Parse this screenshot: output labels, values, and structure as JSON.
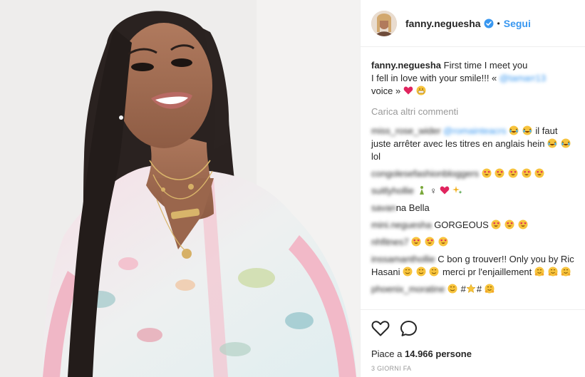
{
  "post": {
    "username": "fanny.neguesha",
    "separator": "•",
    "follow_label": "Segui"
  },
  "caption": {
    "username": "fanny.neguesha",
    "text_line1": "First time I meet you",
    "text_line2": "I fell in love with your smile!!! «",
    "mention": "@tamarr13",
    "text_line3": "voice »"
  },
  "load_more_label": "Carica altri commenti",
  "comments": [
    {
      "user": "miss_rose_wider",
      "mention": "@romainteacrs",
      "text": "il faut juste arrêter avec les titres en anglais hein",
      "tail": "lol"
    },
    {
      "user": "congolesefashionbloggers"
    },
    {
      "user": "suitlyhollie",
      "mid": "♀"
    },
    {
      "user": "savannah",
      "text": "na Bella"
    },
    {
      "user": "mini.neguesha",
      "text": "GORGEOUS"
    },
    {
      "user": "nhfitnes7"
    },
    {
      "user": "inssamanthollie",
      "text": "C bon g trouver!! Only you by Ric Hasani",
      "text2": "merci pr l'enjaillement"
    },
    {
      "user": "phoenix_moratine"
    }
  ],
  "likes": {
    "prefix": "Piace a",
    "count": "14.966",
    "suffix": "persone"
  },
  "timestamp": "3 GIORNI FA",
  "icons": {
    "like": "heart-icon",
    "comment": "comment-icon",
    "verified": "verified-badge-icon"
  },
  "colors": {
    "accent": "#3897f0",
    "muted": "#999999",
    "text": "#262626"
  }
}
